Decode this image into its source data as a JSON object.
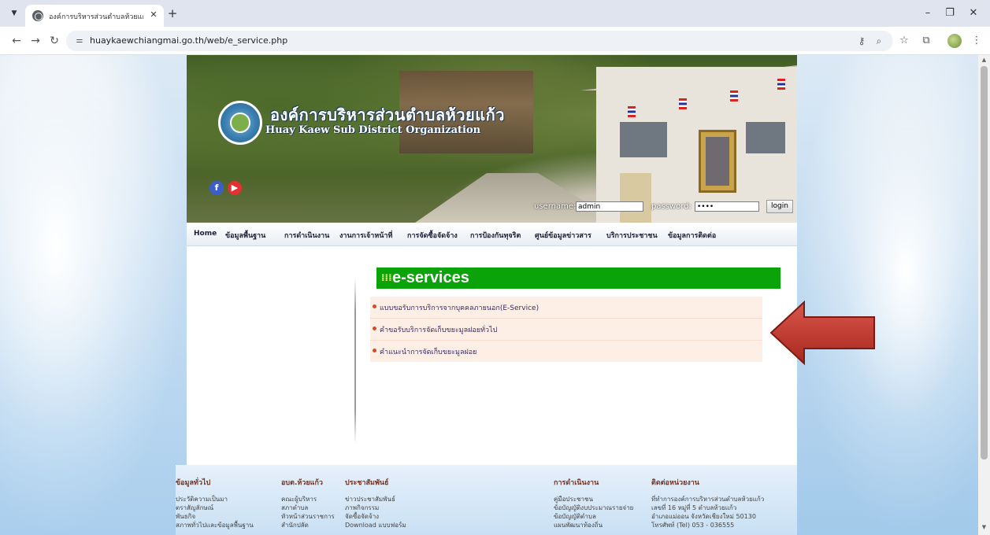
{
  "browser": {
    "tab_title": "องค์การบริหารส่วนตำบลห้วยแก้ว อำเ...",
    "url": "huaykaewchiangmai.go.th/web/e_service.php"
  },
  "banner": {
    "org_name_th": "องค์การบริหารส่วนตำบลห้วยแก้ว",
    "org_name_en": "Huay Kaew Sub District Organization",
    "username_label": "username:",
    "username_value": "admin",
    "password_label": "password:",
    "password_value": "••••",
    "login_button": "login"
  },
  "nav": {
    "items": [
      "Home",
      "ข้อมูลพื้นฐาน",
      "การดำเนินงาน",
      "งานการเจ้าหน้าที่",
      "การจัดซื้อจัดจ้าง",
      "การป้องกันทุจริต",
      "ศูนย์ข้อมูลข่าวสาร",
      "บริการประชาชน",
      "ข้อมูลการติดต่อ"
    ]
  },
  "eservices": {
    "icon": "grid-icon",
    "title": "e-services",
    "items": [
      "แบบขอรับการบริการจากบุคคลภายนอก(E-Service)",
      "คำขอรับบริการจัดเก็บขยะมูลฝอยทั่วไป",
      "คำแนะนำการจัดเก็บขยะมูลฝอย"
    ]
  },
  "footer": {
    "col1": {
      "heading": "ข้อมูลทั่วไป",
      "links": [
        "ประวัติความเป็นมา",
        "ตราสัญลักษณ์",
        "พันธกิจ",
        "สภาพทั่วไปและข้อมูลพื้นฐาน"
      ]
    },
    "col2": {
      "heading": "อบต.ห้วยแก้ว",
      "links": [
        "คณะผู้บริหาร",
        "สภาตำบล",
        "หัวหน้าส่วนราชการ",
        "สำนักปลัด"
      ]
    },
    "col3": {
      "heading": "ประชาสัมพันธ์",
      "links": [
        "ข่าวประชาสัมพันธ์",
        "ภาพกิจกรรม",
        "จัดซื้อจัดจ้าง",
        "Download แบบฟอร์ม"
      ]
    },
    "col4": {
      "heading": "การดำเนินงาน",
      "links": [
        "คู่มือประชาชน",
        "ข้อบัญญัติงบประมาณรายจ่าย",
        "ข้อบัญญัติตำบล",
        "แผนพัฒนาท้องถิ่น"
      ]
    },
    "col5": {
      "heading": "ติดต่อหน่วยงาน",
      "lines": [
        "ที่ทำการองค์การบริหารส่วนตำบลห้วยแก้ว",
        "เลขที่ 16 หมู่ที่ 5 ตำบลห้วยแก้ว",
        "อำเภอแม่ออน จังหวัดเชียงใหม่ 50130",
        "โทรศัพท์ (Tel) 053 - 036555"
      ]
    }
  },
  "colors": {
    "eservices_header": "#0aa30a",
    "eservices_list_bg": "#fdeee6",
    "arrow": "#c0362c",
    "footer_heading": "#7a2f1b"
  }
}
